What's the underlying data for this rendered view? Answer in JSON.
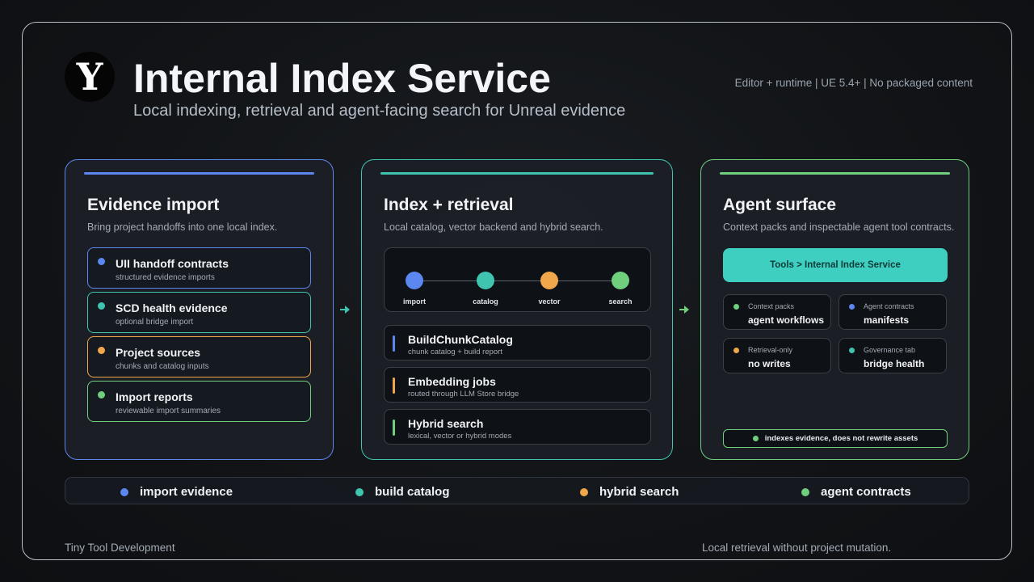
{
  "header": {
    "logo_glyph": "Y",
    "title": "Internal Index Service",
    "subtitle": "Local indexing, retrieval and agent-facing search for Unreal evidence",
    "meta": "Editor + runtime  |  UE 5.4+  |  No packaged content"
  },
  "colors": {
    "blue": "#5c86f0",
    "teal": "#3fc4b0",
    "orange": "#f0a64a",
    "green": "#6fcf7d",
    "cta": "#3ecfc0"
  },
  "panels": {
    "import": {
      "title": "Evidence import",
      "desc": "Bring project handoffs into one local index.",
      "cards": [
        {
          "title": "UII handoff contracts",
          "sub": "structured evidence imports",
          "color": "#5c86f0"
        },
        {
          "title": "SCD health evidence",
          "sub": "optional bridge import",
          "color": "#3fc4b0"
        },
        {
          "title": "Project sources",
          "sub": "chunks and catalog inputs",
          "color": "#f0a64a"
        },
        {
          "title": "Import reports",
          "sub": "reviewable import summaries",
          "color": "#6fcf7d"
        }
      ]
    },
    "retrieval": {
      "title": "Index + retrieval",
      "desc": "Local catalog, vector backend and hybrid search.",
      "pipeline": [
        {
          "label": "import",
          "color": "#5c86f0"
        },
        {
          "label": "catalog",
          "color": "#3fc4b0"
        },
        {
          "label": "vector",
          "color": "#f0a64a"
        },
        {
          "label": "search",
          "color": "#6fcf7d"
        }
      ],
      "steps": [
        {
          "title": "BuildChunkCatalog",
          "sub": "chunk catalog + build report",
          "color": "#5c86f0"
        },
        {
          "title": "Embedding jobs",
          "sub": "routed through LLM Store bridge",
          "color": "#f0a64a"
        },
        {
          "title": "Hybrid search",
          "sub": "lexical, vector or hybrid modes",
          "color": "#6fcf7d"
        }
      ]
    },
    "agent": {
      "title": "Agent surface",
      "desc": "Context packs and inspectable agent tool contracts.",
      "cta": "Tools > Internal Index Service",
      "tiles": [
        {
          "label": "Context packs",
          "value": "agent workflows",
          "color": "#6fcf7d"
        },
        {
          "label": "Agent contracts",
          "value": "manifests",
          "color": "#5c86f0"
        },
        {
          "label": "Retrieval-only",
          "value": "no writes",
          "color": "#f0a64a"
        },
        {
          "label": "Governance tab",
          "value": "bridge health",
          "color": "#3fc4b0"
        }
      ],
      "note": "indexes evidence, does not rewrite assets"
    }
  },
  "legend": [
    {
      "label": "import evidence",
      "color": "#5c86f0"
    },
    {
      "label": "build catalog",
      "color": "#3fc4b0"
    },
    {
      "label": "hybrid search",
      "color": "#f0a64a"
    },
    {
      "label": "agent contracts",
      "color": "#6fcf7d"
    }
  ],
  "footer": {
    "left": "Tiny Tool Development",
    "right": "Local retrieval without project mutation."
  }
}
